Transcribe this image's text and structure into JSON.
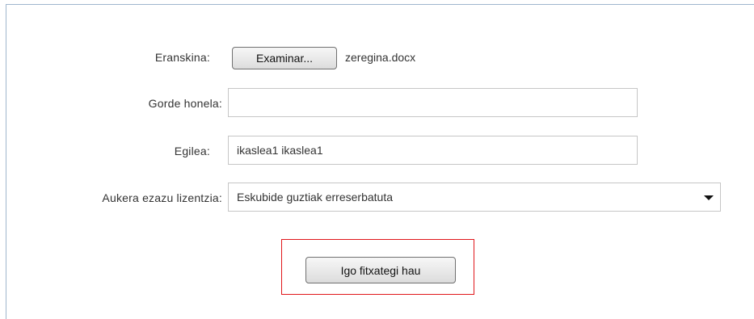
{
  "form": {
    "attachment": {
      "label": "Eranskina:",
      "browse_button": "Examinar...",
      "file_name": "zeregina.docx"
    },
    "save_as": {
      "label": "Gorde honela:",
      "value": "",
      "placeholder": ""
    },
    "author": {
      "label": "Egilea:",
      "value": "ikaslea1 ikaslea1"
    },
    "license": {
      "label": "Aukera ezazu lizentzia:",
      "selected": "Eskubide guztiak erreserbatuta",
      "icon": "chevron-down-icon"
    },
    "upload_button": "Igo fitxategi hau"
  },
  "colors": {
    "panel_border": "#9fb6cd",
    "highlight": "#e0161b",
    "input_border": "#c6c6c6",
    "text": "#333333"
  }
}
